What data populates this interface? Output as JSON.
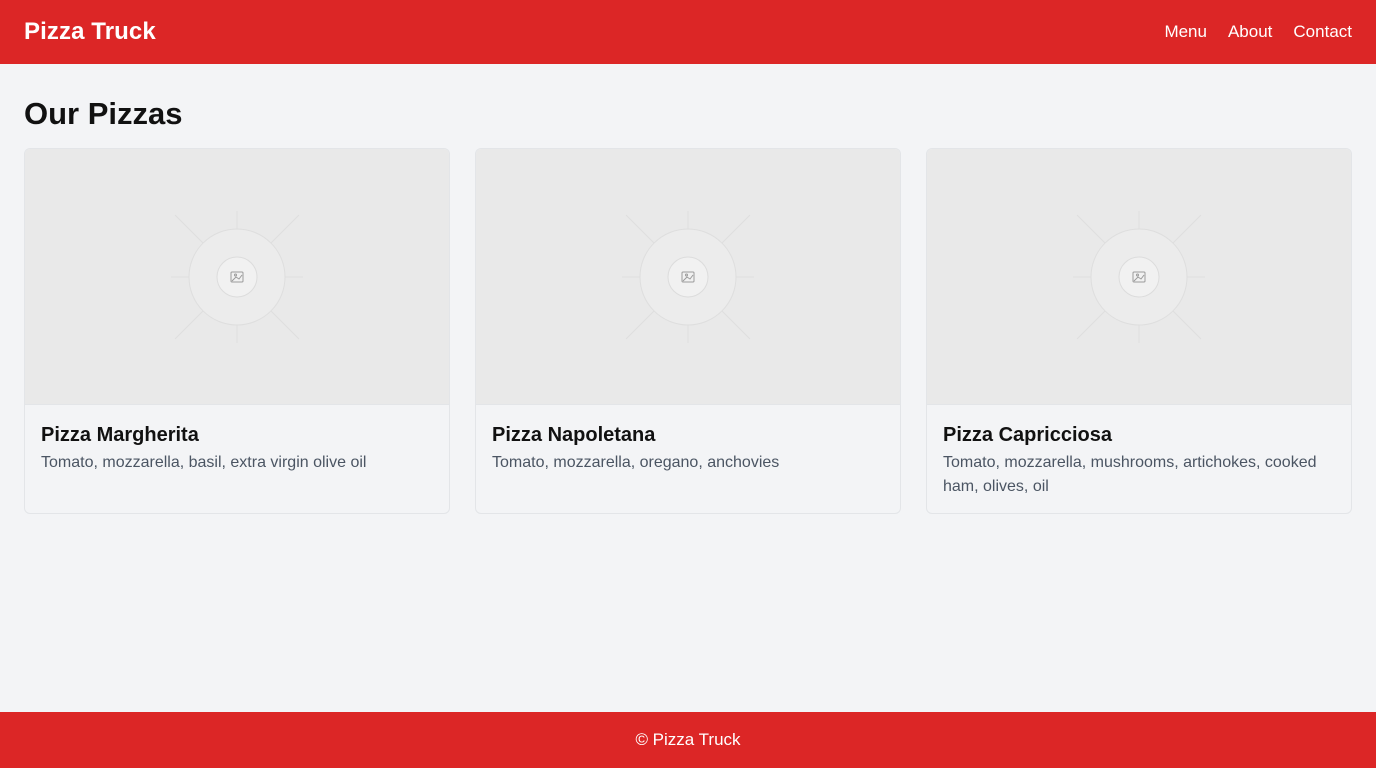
{
  "header": {
    "brand": "Pizza Truck",
    "nav": [
      {
        "label": "Menu"
      },
      {
        "label": "About"
      },
      {
        "label": "Contact"
      }
    ]
  },
  "main": {
    "title": "Our Pizzas",
    "cards": [
      {
        "title": "Pizza Margherita",
        "description": "Tomato, mozzarella, basil, extra virgin olive oil",
        "image_icon": "image-placeholder-icon"
      },
      {
        "title": "Pizza Napoletana",
        "description": "Tomato, mozzarella, oregano, anchovies",
        "image_icon": "image-placeholder-icon"
      },
      {
        "title": "Pizza Capricciosa",
        "description": "Tomato, mozzarella, mushrooms, artichokes, cooked ham, olives, oil",
        "image_icon": "image-placeholder-icon"
      }
    ]
  },
  "footer": {
    "text": "© Pizza Truck"
  },
  "colors": {
    "brand_red": "#dc2626",
    "page_bg": "#f3f4f6",
    "muted_text": "#4b5563"
  }
}
